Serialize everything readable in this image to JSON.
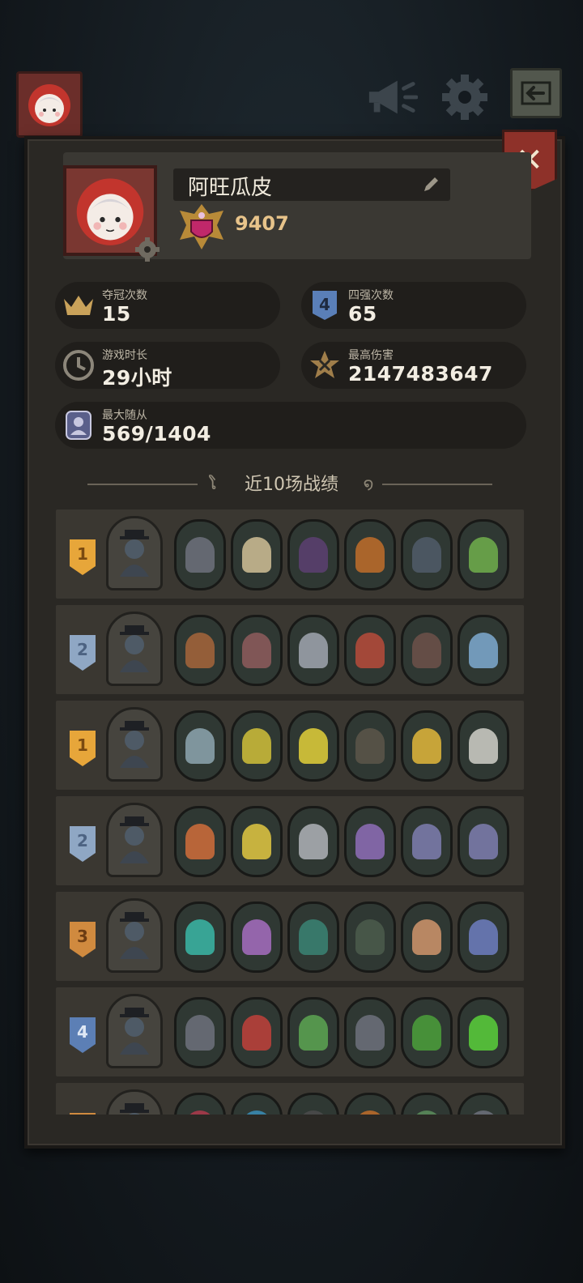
{
  "topbar": {
    "avatar_icon": "red-hood-girl-avatar",
    "buttons": [
      "megaphone-icon",
      "gear-icon",
      "exit-icon"
    ]
  },
  "profile": {
    "name": "阿旺瓜皮",
    "trophies": "9407"
  },
  "stats": [
    {
      "label": "夺冠次数",
      "value": "15",
      "icon": "crown-icon"
    },
    {
      "label": "四强次数",
      "value": "65",
      "icon": "rank-four-icon"
    },
    {
      "label": "游戏时长",
      "value": "29小时",
      "icon": "clock-icon"
    },
    {
      "label": "最高伤害",
      "value": "2147483647",
      "icon": "damage-star-icon"
    },
    {
      "label": "最大随从",
      "value": "569/1404",
      "icon": "minion-icon"
    }
  ],
  "history": {
    "title": "近10场战绩",
    "matches": [
      {
        "rank": "1",
        "rank_color": "gold",
        "units": [
          "#6a6e78",
          "#c8b890",
          "#5a3f6e",
          "#b86a2a",
          "#4f5a66",
          "#6da84a"
        ]
      },
      {
        "rank": "2",
        "rank_color": "silver",
        "units": [
          "#a0633a",
          "#8a5a5a",
          "#9aa0a8",
          "#b04a3a",
          "#6a5048",
          "#7aa4c8"
        ]
      },
      {
        "rank": "1",
        "rank_color": "gold",
        "units": [
          "#88a0a8",
          "#c8b838",
          "#d8c838",
          "#5a5448",
          "#d8b03a",
          "#c8c8c0"
        ]
      },
      {
        "rank": "2",
        "rank_color": "silver",
        "units": [
          "#c86a3a",
          "#d8c040",
          "#a8acb0",
          "#8a6ab0",
          "#7a7aa8",
          "#7a7aa8"
        ]
      },
      {
        "rank": "3",
        "rank_color": "bronze",
        "units": [
          "#3ab0a0",
          "#a06ab8",
          "#3a8070",
          "#4a5a4a",
          "#c89068",
          "#6a7ab8"
        ]
      },
      {
        "rank": "4",
        "rank_color": "blue",
        "units": [
          "#6a6e78",
          "#b8403a",
          "#5aa050",
          "#6a6e78",
          "#4a9a3a",
          "#58c83a"
        ]
      },
      {
        "rank": "",
        "rank_color": "bronze",
        "units": [
          "#a83a4a",
          "#3a8ab0",
          "#4a4a4a",
          "#b86a2a",
          "#5a8a5a",
          "#6a6e78"
        ]
      }
    ]
  }
}
